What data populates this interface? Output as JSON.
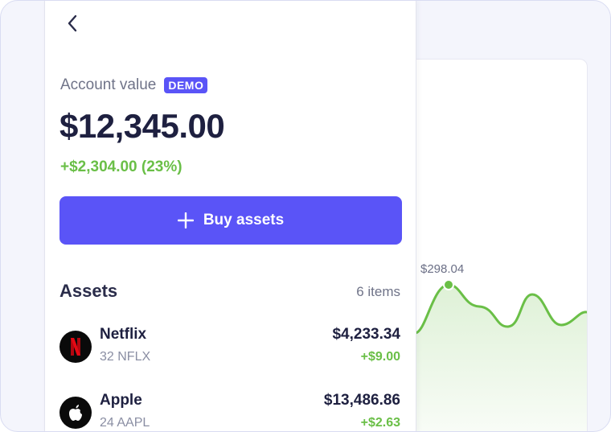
{
  "account": {
    "label": "Account value",
    "badge": "DEMO",
    "value": "$12,345.00",
    "change": "+$2,304.00 (23%)"
  },
  "buy_button": {
    "label": "Buy assets",
    "icon": "plus-icon"
  },
  "assets": {
    "title": "Assets",
    "count": "6 items",
    "items": [
      {
        "name": "Netflix",
        "sub": "32 NFLX",
        "value": "$4,233.34",
        "change": "+$9.00",
        "icon": "netflix-logo-icon"
      },
      {
        "name": "Apple",
        "sub": "24 AAPL",
        "value": "$13,486.86",
        "change": "+$2.63",
        "icon": "apple-logo-icon"
      }
    ]
  },
  "chart": {
    "highlight_label": "$298.04",
    "line_color": "#6abf47",
    "accent_color": "#5a54f7"
  }
}
